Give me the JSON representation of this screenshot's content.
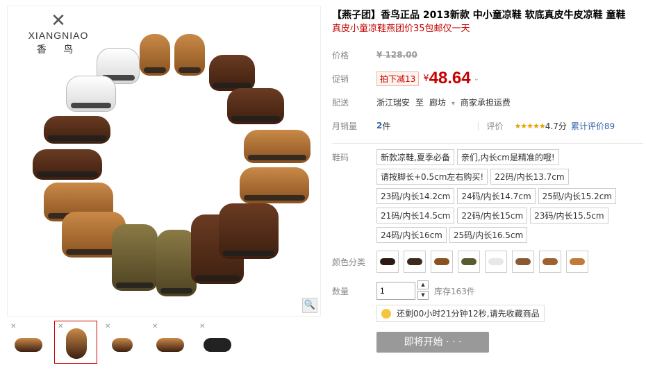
{
  "brand": {
    "name_en": "XIANGNIAO",
    "name_cn": "香 鸟"
  },
  "product": {
    "title": "【燕子团】香鸟正品 2013新款 中小童凉鞋 软底真皮牛皮凉鞋 童鞋",
    "subtitle": "真皮小童凉鞋燕团价35包邮仅一天"
  },
  "price": {
    "label": "价格",
    "original": "¥ 128.00",
    "promo_label": "促销",
    "promo_tag": "拍下减13",
    "yen": "¥",
    "current": "48.64"
  },
  "shipping": {
    "label": "配送",
    "from": "浙江瑞安",
    "to_word": "至",
    "to": "廊坊",
    "fee": "商家承担运费"
  },
  "sales": {
    "label": "月销量",
    "count": "2",
    "unit": "件",
    "rating_label": "评价",
    "stars": "★★★★★",
    "score": "4.7分",
    "reviews": "累计评价89"
  },
  "size": {
    "label": "鞋码",
    "options": [
      "新款凉鞋,夏季必备",
      "亲们,内长cm是精准的哦!",
      "请按脚长+0.5cm左右购买!",
      "22码/内长13.7cm",
      "23码/内长14.2cm",
      "24码/内长14.7cm",
      "25码/内长15.2cm",
      "21码/内长14.5cm",
      "22码/内长15cm",
      "23码/内长15.5cm",
      "24码/内长16cm",
      "25码/内长16.5cm"
    ]
  },
  "color": {
    "label": "颜色分类",
    "swatches": [
      "#2a1a12",
      "#3d2a1e",
      "#8a5220",
      "#5a5a30",
      "#e8e8e8",
      "#8a5a30",
      "#a06030",
      "#c07a3a"
    ]
  },
  "quantity": {
    "label": "数量",
    "value": "1",
    "stock": "库存163件"
  },
  "notice": {
    "text": "还剩00小时21分钟12秒,请先收藏商品"
  },
  "action": {
    "start_label": "即将开始 · · ·"
  },
  "colors": {
    "accent": "#c40000",
    "link": "#3366aa",
    "star": "#e8a000"
  }
}
